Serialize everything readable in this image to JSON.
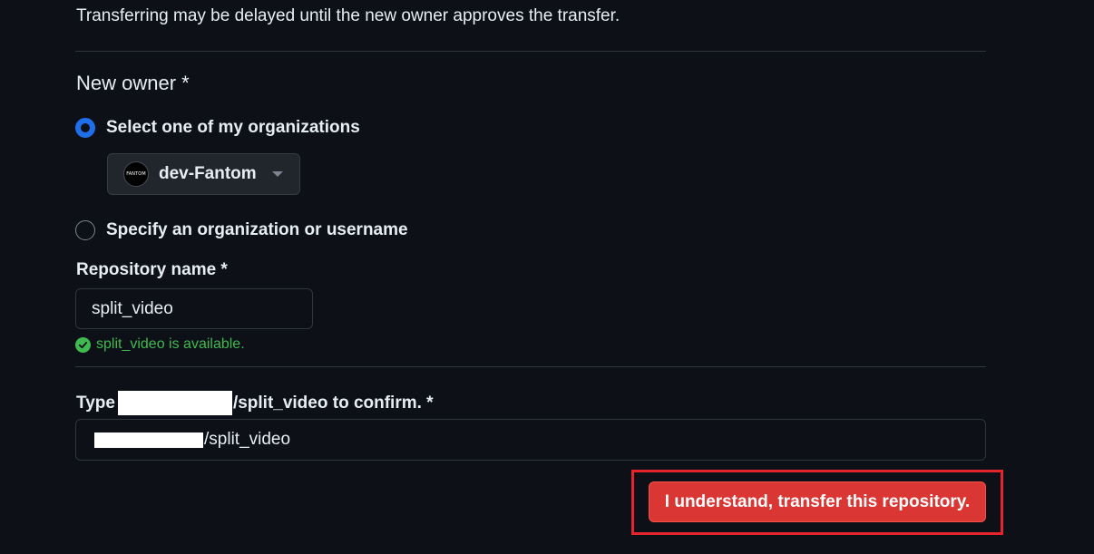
{
  "notice": "Transferring may be delayed until the new owner approves the transfer.",
  "new_owner": {
    "heading": "New owner *",
    "option_orgs": {
      "label": "Select one of my organizations",
      "checked": true,
      "selected_org": {
        "name": "dev-Fantom",
        "avatar_text": "FANTOM"
      }
    },
    "option_specify": {
      "label": "Specify an organization or username",
      "checked": false
    }
  },
  "repository_name": {
    "label": "Repository name *",
    "value": "split_video",
    "availability": "split_video is available."
  },
  "confirm": {
    "label_prefix": "Type",
    "label_suffix": "/split_video to confirm. *",
    "value_suffix": "/split_video"
  },
  "transfer_button": {
    "label": "I understand, transfer this repository."
  },
  "colors": {
    "background": "#0d1117",
    "accent_radio": "#1f6feb",
    "success": "#3fb950",
    "danger": "#da3633",
    "highlight_box": "#e5252e"
  }
}
